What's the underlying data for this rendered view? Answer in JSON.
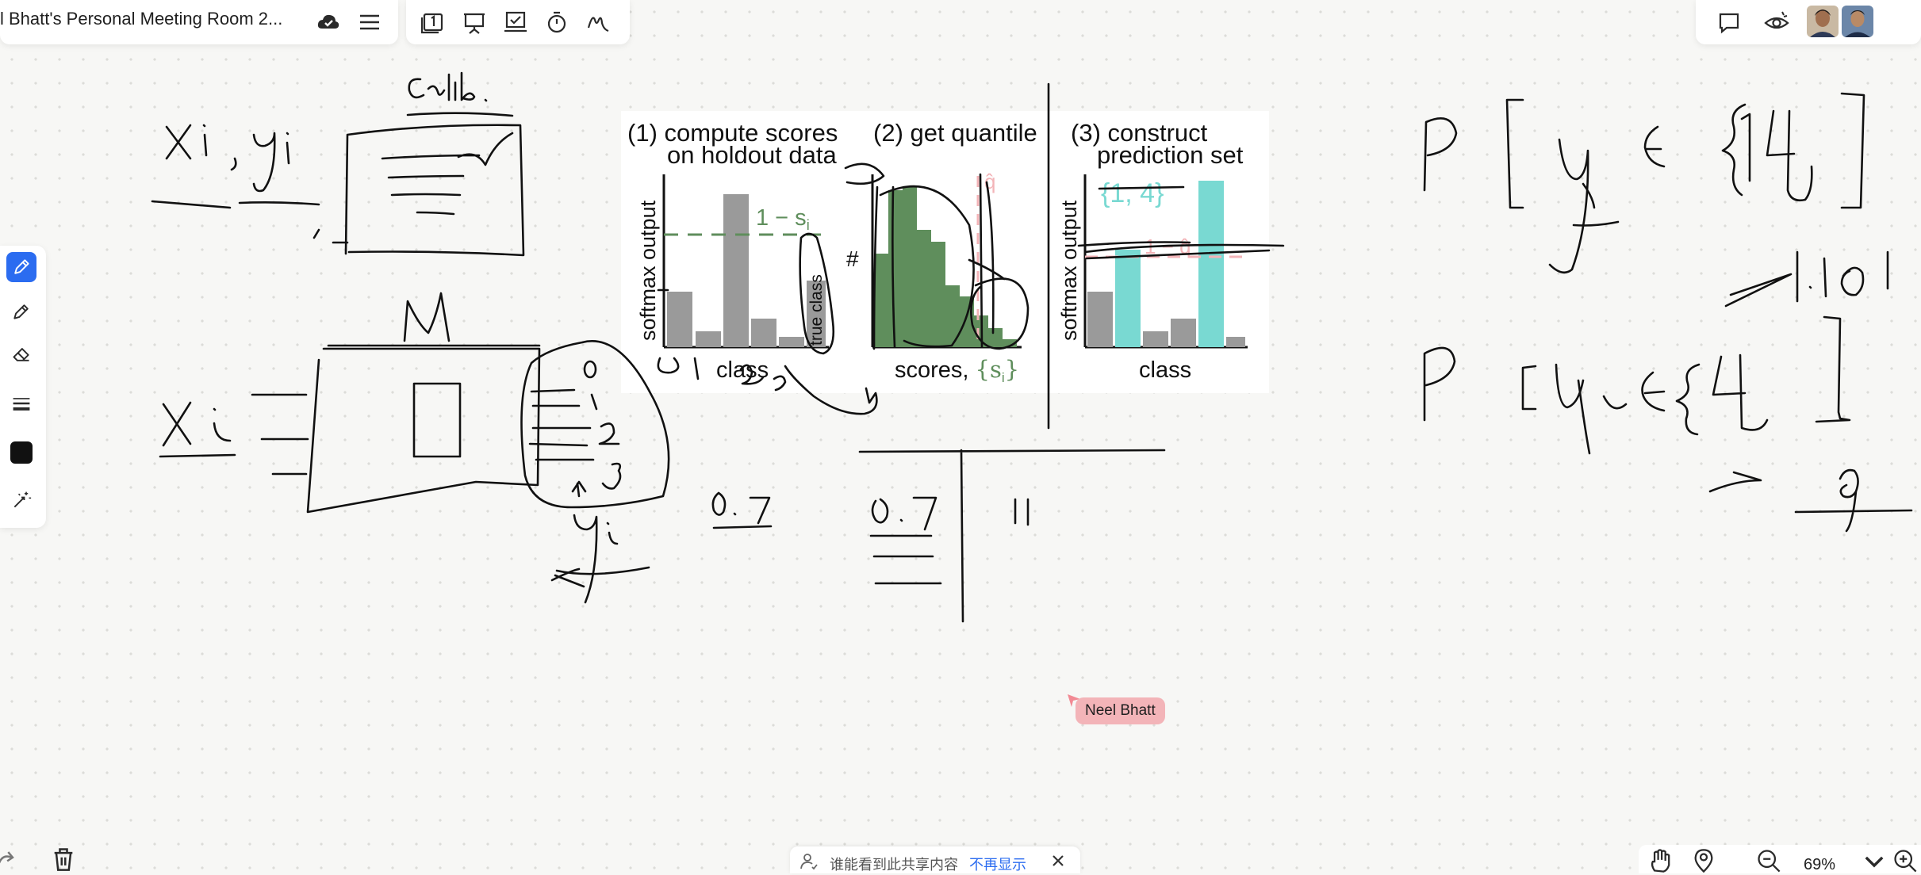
{
  "title_bar": {
    "title": "l Bhatt's Personal Meeting Room 2..."
  },
  "top_tools": [
    "page-number-icon",
    "present-icon",
    "vote-icon",
    "timer-icon",
    "signature-icon"
  ],
  "top_right": [
    "chat-icon",
    "follow-view-icon",
    "avatar",
    "avatar"
  ],
  "left_tools": [
    "pen-icon",
    "pencil-icon",
    "eraser-icon",
    "stroke-width-icon",
    "color-swatch",
    "magic-pen-icon"
  ],
  "colors": {
    "accent": "#2b6cf0",
    "swatch": "#111111",
    "cursor_tag": "#f3b4b8",
    "teal": "#79d9d2",
    "green": "#5f8e5c",
    "gray": "#9a9a9a"
  },
  "cursor": {
    "name": "Neel Bhatt"
  },
  "figure": {
    "panel1_title_line1": "(1) compute scores",
    "panel1_title_line2": "on holdout data",
    "panel1_ylabel": "softmax output",
    "panel1_xlabel": "class",
    "panel1_threshold": "1 − s",
    "panel1_threshold_sub": "i",
    "panel1_rotated": "true class",
    "panel2_title": "(2) get quantile",
    "panel2_ylabel": "#",
    "panel2_qhat": "q̂",
    "panel2_xlabel": "scores, ",
    "panel2_xlabel_set": "{s",
    "panel2_xlabel_set_sub": "i",
    "panel2_xlabel_set_end": "}",
    "panel3_title_line1": "(3) construct",
    "panel3_title_line2": "prediction set",
    "panel3_set": "{1, 4}",
    "panel3_threshold": "1 − q̂",
    "panel3_ylabel": "softmax output",
    "panel3_xlabel": "class"
  },
  "bottom_notice": {
    "text": "谁能看到此共享内容",
    "link": "不再显示"
  },
  "zoom": {
    "value": "69%"
  }
}
